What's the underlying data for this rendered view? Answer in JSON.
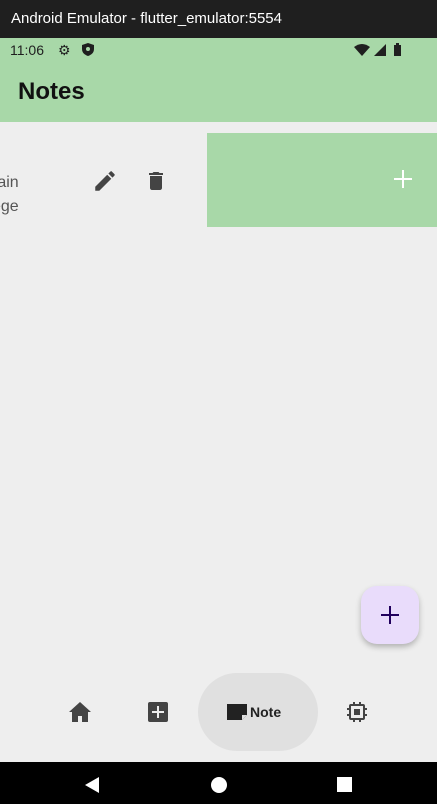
{
  "window": {
    "title": "Android Emulator - flutter_emulator:5554"
  },
  "status_bar": {
    "time": "11:06",
    "icons": [
      "gear-icon",
      "shield-icon",
      "wifi-icon",
      "signal-icon",
      "battery-icon"
    ]
  },
  "app_bar": {
    "title": "Notes"
  },
  "notes": [
    {
      "title_fragment": "rain",
      "content_fragment": "ege"
    }
  ],
  "add_panel": {
    "icon": "plus-icon"
  },
  "fab": {
    "icon": "plus-icon"
  },
  "bottom_nav": {
    "items": [
      {
        "icon": "home-icon",
        "label": "",
        "selected": false
      },
      {
        "icon": "add-box-icon",
        "label": "",
        "selected": false
      },
      {
        "icon": "note-icon",
        "label": "Note",
        "selected": true
      },
      {
        "icon": "chip-icon",
        "label": "",
        "selected": false
      }
    ]
  },
  "system_nav": {
    "icons": [
      "back-icon",
      "home-circle-icon",
      "recents-icon"
    ]
  },
  "colors": {
    "app_bar": "#a8d8a8",
    "background": "#eeeeee",
    "fab": "#e9dcfb",
    "nav_selected": "#e0e0e0"
  }
}
